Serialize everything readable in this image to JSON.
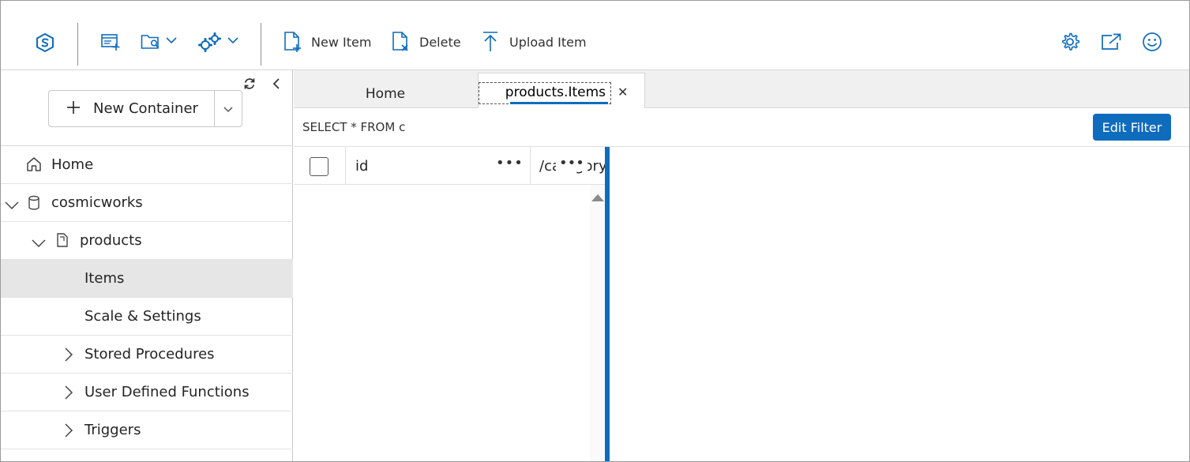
{
  "toolbar": {
    "new_item": "New Item",
    "delete": "Delete",
    "upload_item": "Upload Item"
  },
  "sidebar": {
    "new_container_label": "New Container",
    "tree": [
      {
        "label": "Home"
      },
      {
        "label": "cosmicworks"
      },
      {
        "label": "products"
      },
      {
        "label": "Items"
      },
      {
        "label": "Scale & Settings"
      },
      {
        "label": "Stored Procedures"
      },
      {
        "label": "User Defined Functions"
      },
      {
        "label": "Triggers"
      }
    ]
  },
  "tabs": [
    {
      "label": "Home"
    },
    {
      "label": "products.Items"
    }
  ],
  "query": {
    "text": "SELECT * FROM c",
    "edit_filter_label": "Edit Filter"
  },
  "grid": {
    "columns": [
      {
        "label": "id"
      },
      {
        "label": "/category"
      }
    ]
  },
  "colors": {
    "accent": "#0f6cbd",
    "selected_row": "#e6e6e6"
  },
  "icons": {
    "logo": "cosmos-logo-icon",
    "new_collection": "new-collection-icon",
    "open_query": "open-query-icon",
    "settings_menu": "gear-cluster-icon",
    "settings": "gear-icon",
    "open_full_screen": "open-external-icon",
    "feedback": "smiley-icon"
  }
}
